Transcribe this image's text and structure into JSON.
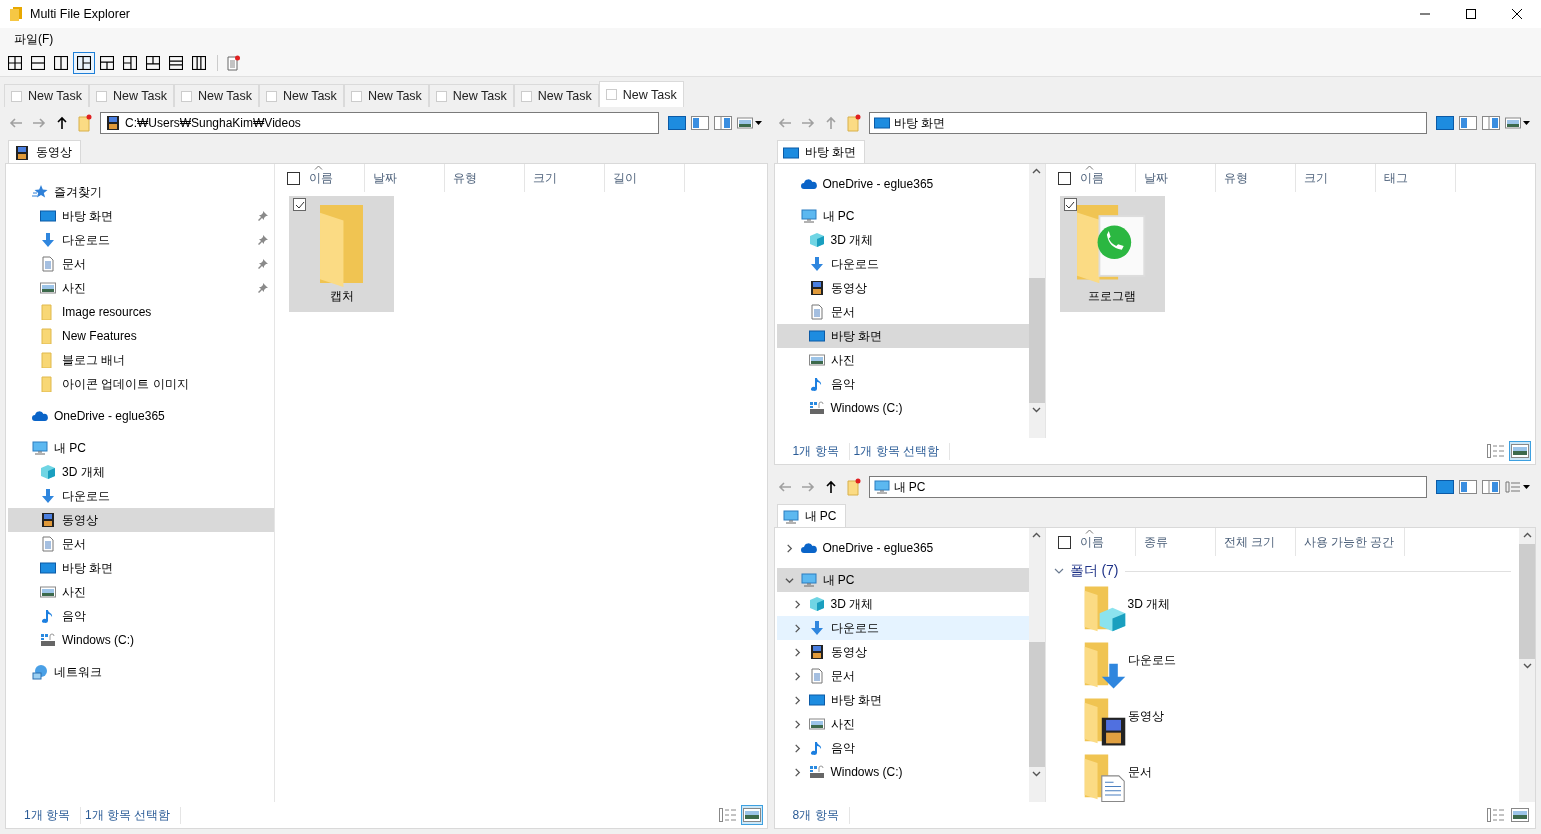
{
  "window": {
    "title": "Multi File Explorer"
  },
  "menu": [
    {
      "label": "파일(F)"
    }
  ],
  "layout_buttons": [
    {
      "kind": "grid",
      "selected": false
    },
    {
      "kind": "rows",
      "selected": false
    },
    {
      "kind": "cols",
      "selected": false
    },
    {
      "kind": "cols-right-split",
      "selected": true
    },
    {
      "kind": "rows-bottom-split",
      "selected": false
    },
    {
      "kind": "cols-left-split",
      "selected": false
    },
    {
      "kind": "rows-top-split",
      "selected": false
    },
    {
      "kind": "rows3",
      "selected": false
    },
    {
      "kind": "cols3",
      "selected": false
    }
  ],
  "tasks": [
    {
      "label": "New Task",
      "checked": false,
      "selected": false
    },
    {
      "label": "New Task",
      "checked": false,
      "selected": false
    },
    {
      "label": "New Task",
      "checked": false,
      "selected": false
    },
    {
      "label": "New Task",
      "checked": false,
      "selected": false
    },
    {
      "label": "New Task",
      "checked": false,
      "selected": false
    },
    {
      "label": "New Task",
      "checked": false,
      "selected": false
    },
    {
      "label": "New Task",
      "checked": false,
      "selected": false
    },
    {
      "label": "New Task",
      "checked": false,
      "selected": true
    }
  ],
  "panes": [
    {
      "nav": [
        {
          "kind": "back",
          "disabled": true
        },
        {
          "kind": "forward",
          "disabled": true
        },
        {
          "kind": "up",
          "disabled": false
        }
      ],
      "address": {
        "kind": "film",
        "path": "C:₩Users₩SunghaKim₩Videos"
      },
      "view_menu": {
        "kind": "picture"
      },
      "tab": {
        "kind": "film",
        "label": "동영상"
      },
      "tree": [
        {
          "kind": "star",
          "label": "즐겨찾기",
          "selected": false,
          "children": [
            {
              "kind": "desktop",
              "label": "바탕 화면",
              "selected": false,
              "pinned": true
            },
            {
              "kind": "download",
              "label": "다운로드",
              "selected": false,
              "pinned": true
            },
            {
              "kind": "document",
              "label": "문서",
              "selected": false,
              "pinned": true
            },
            {
              "kind": "picture",
              "label": "사진",
              "selected": false,
              "pinned": true
            },
            {
              "kind": "folder",
              "label": "Image resources",
              "selected": false
            },
            {
              "kind": "folder",
              "label": "New Features",
              "selected": false
            },
            {
              "kind": "folder",
              "label": "블로그 배너",
              "selected": false
            },
            {
              "kind": "folder",
              "label": "아이콘 업데이트 이미지",
              "selected": false
            }
          ]
        },
        {
          "kind": "cloud",
          "label": "OneDrive - eglue365",
          "selected": false
        },
        {
          "kind": "pc",
          "label": "내 PC",
          "selected": false,
          "children": [
            {
              "kind": "cube",
              "label": "3D 개체",
              "selected": false
            },
            {
              "kind": "download",
              "label": "다운로드",
              "selected": false
            },
            {
              "kind": "film",
              "label": "동영상",
              "selected": true
            },
            {
              "kind": "document",
              "label": "문서",
              "selected": false
            },
            {
              "kind": "desktop",
              "label": "바탕 화면",
              "selected": false
            },
            {
              "kind": "picture",
              "label": "사진",
              "selected": false
            },
            {
              "kind": "music",
              "label": "음악",
              "selected": false
            },
            {
              "kind": "drive",
              "label": "Windows  (C:)",
              "selected": false
            }
          ]
        },
        {
          "kind": "network",
          "label": "네트워크",
          "selected": false
        }
      ],
      "columns": [
        "이름",
        "날짜",
        "유형",
        "크기",
        "길이"
      ],
      "select_all_checked": false,
      "content": {
        "kind": "icons",
        "items": [
          {
            "label": "캡처",
            "kind": "plain",
            "selected": true,
            "checked": true
          }
        ]
      },
      "status": [
        "1개 항목",
        "1개 항목 선택함"
      ],
      "view_buttons": [
        {
          "kind": "details",
          "selected": false
        },
        {
          "kind": "icons",
          "selected": true
        }
      ]
    },
    {
      "nav": [
        {
          "kind": "back",
          "disabled": true
        },
        {
          "kind": "forward",
          "disabled": true
        },
        {
          "kind": "up",
          "disabled": true
        }
      ],
      "address": {
        "kind": "desktop",
        "path": "바탕 화면"
      },
      "view_menu": {
        "kind": "picture"
      },
      "tab": {
        "kind": "desktop",
        "label": "바탕 화면"
      },
      "tree": [
        {
          "kind": "cloud",
          "label": "OneDrive - eglue365",
          "selected": false
        },
        {
          "kind": "pc",
          "label": "내 PC",
          "selected": false,
          "children": [
            {
              "kind": "cube",
              "label": "3D 개체",
              "selected": false
            },
            {
              "kind": "download",
              "label": "다운로드",
              "selected": false
            },
            {
              "kind": "film",
              "label": "동영상",
              "selected": false
            },
            {
              "kind": "document",
              "label": "문서",
              "selected": false
            },
            {
              "kind": "desktop",
              "label": "바탕 화면",
              "selected": true
            },
            {
              "kind": "picture",
              "label": "사진",
              "selected": false
            },
            {
              "kind": "music",
              "label": "음악",
              "selected": false
            },
            {
              "kind": "drive",
              "label": "Windows  (C:)",
              "selected": false
            }
          ]
        }
      ],
      "columns": [
        "이름",
        "날짜",
        "유형",
        "크기",
        "태그"
      ],
      "select_all_checked": false,
      "content": {
        "kind": "icons",
        "items": [
          {
            "label": "프로그램",
            "kind": "app",
            "selected": true,
            "checked": true
          }
        ]
      },
      "status": [
        "1개 항목",
        "1개 항목 선택함"
      ],
      "view_buttons": [
        {
          "kind": "details",
          "selected": false
        },
        {
          "kind": "icons",
          "selected": true
        }
      ]
    },
    {
      "nav": [
        {
          "kind": "back",
          "disabled": true
        },
        {
          "kind": "forward",
          "disabled": true
        },
        {
          "kind": "up",
          "disabled": false
        }
      ],
      "address": {
        "kind": "pc",
        "path": "내 PC"
      },
      "view_menu": {
        "kind": "list"
      },
      "tab": {
        "kind": "pc",
        "label": "내 PC"
      },
      "tree": [
        {
          "kind": "cloud",
          "label": "OneDrive - eglue365",
          "selected": false,
          "hovered": false,
          "expanded": false
        },
        {
          "kind": "pc",
          "label": "내 PC",
          "selected": true,
          "hovered": false,
          "expanded": true,
          "children": [
            {
              "kind": "cube",
              "label": "3D 개체",
              "selected": false,
              "hovered": false,
              "expanded": false
            },
            {
              "kind": "download",
              "label": "다운로드",
              "selected": false,
              "hovered": true,
              "expanded": false
            },
            {
              "kind": "film",
              "label": "동영상",
              "selected": false,
              "hovered": false,
              "expanded": false
            },
            {
              "kind": "document",
              "label": "문서",
              "selected": false,
              "hovered": false,
              "expanded": false
            },
            {
              "kind": "desktop",
              "label": "바탕 화면",
              "selected": false,
              "hovered": false,
              "expanded": false
            },
            {
              "kind": "picture",
              "label": "사진",
              "selected": false,
              "hovered": false,
              "expanded": false
            },
            {
              "kind": "music",
              "label": "음악",
              "selected": false,
              "hovered": false,
              "expanded": false
            },
            {
              "kind": "drive",
              "label": "Windows  (C:)",
              "selected": false,
              "hovered": false,
              "expanded": false
            }
          ]
        }
      ],
      "columns": [
        "이름",
        "종류",
        "전체 크기",
        "사용 가능한 공간"
      ],
      "select_all_checked": false,
      "content": {
        "kind": "tiles",
        "groups": [
          {
            "label": "폴더 (7)",
            "expanded": true,
            "items": [
              {
                "label": "3D 개체",
                "kind": "cube",
                "selected": false
              },
              {
                "label": "다운로드",
                "kind": "download",
                "selected": false
              },
              {
                "label": "동영상",
                "kind": "film",
                "selected": false
              },
              {
                "label": "문서",
                "kind": "document",
                "selected": false
              }
            ]
          }
        ]
      },
      "status": [
        "8개 항목"
      ],
      "view_buttons": [
        {
          "kind": "details",
          "selected": false
        },
        {
          "kind": "icons",
          "selected": false
        }
      ]
    }
  ]
}
